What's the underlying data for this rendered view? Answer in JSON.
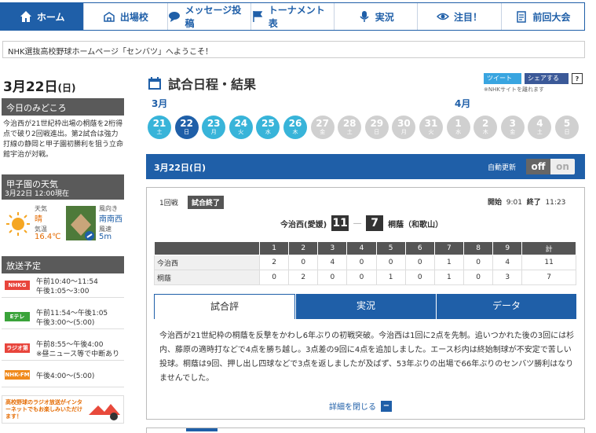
{
  "nav": {
    "items": [
      {
        "label": "ホーム",
        "icon": "home-icon"
      },
      {
        "label": "出場校",
        "icon": "school-icon"
      },
      {
        "label": "メッセージ投稿",
        "icon": "message-icon"
      },
      {
        "label": "トーナメント表",
        "icon": "flag-icon"
      },
      {
        "label": "実況",
        "icon": "microphone-icon"
      },
      {
        "label": "注目！",
        "icon": "eye-icon"
      },
      {
        "label": "前回大会",
        "icon": "clipboard-icon"
      }
    ]
  },
  "welcome": "NHK選抜高校野球ホームページ「センバツ」へようこそ！",
  "left": {
    "date_main": "3月22日",
    "date_day": "(日)",
    "midokoro_head": "今日のみどころ",
    "midokoro_text": "今治西が21世紀枠出場の桐蔭を2桁得点で破り2回戦進出。第2試合は強力打線の静岡と甲子園初勝利を狙う立命館宇治が対戦。",
    "weather_head": "甲子園の天気",
    "weather_time": "3月22日 12:00現在",
    "weather": {
      "tenki_label": "天気",
      "tenki": "晴",
      "kion_label": "気温",
      "kion": "16.4℃",
      "fuko_label": "風向き",
      "fuko": "南南西",
      "fusoku_label": "風速",
      "fusoku": "5m"
    },
    "broadcast_head": "放送予定",
    "broadcast": [
      {
        "channel": "NHKG",
        "color": "#e8453c",
        "lines": [
          "午前10:40～11:54",
          "午後1:05～3:00"
        ]
      },
      {
        "channel": "Eテレ",
        "color": "#3aa33a",
        "lines": [
          "午前11:54～午後1:05",
          "午後3:00～(5:00)"
        ]
      },
      {
        "channel": "ラジオ第1",
        "color": "#e8453c",
        "lines": [
          "午前8:55～午後4:00",
          "※昼ニュース等で中断あり"
        ]
      },
      {
        "channel": "NHK-FM",
        "color": "#f08a1c",
        "lines": [
          "午後4:00～(5:00)"
        ]
      }
    ],
    "radio_banner": "高校野球のラジオ放送がインターネットでもお楽しみいただけます！"
  },
  "main": {
    "title": "試合日程・結果",
    "tweet": "ツイート",
    "share": "シェアする",
    "help": "?",
    "share_note": "※NHKサイトを離れます",
    "month_march": "3月",
    "month_april": "4月",
    "days": [
      {
        "n": "21",
        "w": "土",
        "state": "blue"
      },
      {
        "n": "22",
        "w": "日",
        "state": "sel"
      },
      {
        "n": "23",
        "w": "月",
        "state": "blue"
      },
      {
        "n": "24",
        "w": "火",
        "state": "blue"
      },
      {
        "n": "25",
        "w": "水",
        "state": "blue"
      },
      {
        "n": "26",
        "w": "木",
        "state": "blue"
      },
      {
        "n": "27",
        "w": "金",
        "state": "gray"
      },
      {
        "n": "28",
        "w": "土",
        "state": "gray"
      },
      {
        "n": "29",
        "w": "日",
        "state": "gray"
      },
      {
        "n": "30",
        "w": "月",
        "state": "gray"
      },
      {
        "n": "31",
        "w": "火",
        "state": "gray"
      },
      {
        "n": "1",
        "w": "水",
        "state": "gray"
      },
      {
        "n": "2",
        "w": "木",
        "state": "gray"
      },
      {
        "n": "3",
        "w": "金",
        "state": "gray"
      },
      {
        "n": "4",
        "w": "土",
        "state": "gray"
      },
      {
        "n": "5",
        "w": "日",
        "state": "gray"
      }
    ],
    "bar_date": "3月22日(日)",
    "auto_update": "自動更新",
    "toggle_off": "off",
    "toggle_on": "on"
  },
  "game": {
    "round": "1回戦",
    "status": "試合終了",
    "start_label": "開始",
    "start": "9:01",
    "end_label": "終了",
    "end": "11:23",
    "home": "今治西(愛媛)",
    "home_score": "11",
    "dash": "―",
    "away_score": "7",
    "away": "桐蔭（和歌山）",
    "headers": [
      "",
      "1",
      "2",
      "3",
      "4",
      "5",
      "6",
      "7",
      "8",
      "9",
      "計"
    ],
    "rows": [
      [
        "今治西",
        "2",
        "0",
        "4",
        "0",
        "0",
        "0",
        "1",
        "0",
        "4",
        "11"
      ],
      [
        "桐蔭",
        "0",
        "2",
        "0",
        "0",
        "1",
        "0",
        "1",
        "0",
        "3",
        "7"
      ]
    ],
    "tabs": [
      "試合評",
      "実況",
      "データ"
    ],
    "report": "今治西が21世紀枠の桐蔭を反撃をかわし6年ぶりの初戦突破。今治西は1回に2点を先制。追いつかれた後の3回には杉内、藤原の適時打などで4点を勝ち越し。3点差の9回に4点を追加しました。エース杉内は終始制球が不安定で苦しい投球。桐蔭は9回、押し出し四球などで3点を返しましたが及ばず、53年ぶりの出場で66年ぶりのセンバツ勝利はなりませんでした。",
    "close": "詳細を閉じる"
  }
}
